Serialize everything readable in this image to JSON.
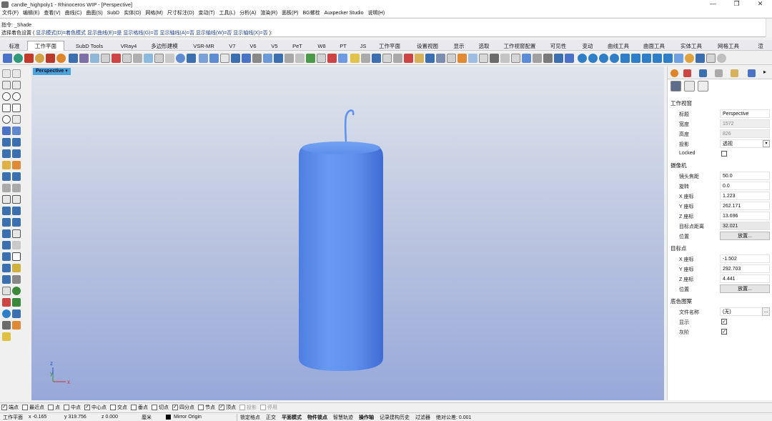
{
  "window": {
    "title": "candle_highpoly1 - Rhinoceros WIP - [Perspective]",
    "controls": [
      "—",
      "❐",
      "✕"
    ]
  },
  "menubar": [
    "文件(F)",
    "编辑(E)",
    "查看(V)",
    "曲线(C)",
    "曲面(S)",
    "SubD",
    "实体(O)",
    "网格(M)",
    "尺寸标注(D)",
    "变动(T)",
    "工具(L)",
    "分析(A)",
    "渲染(R)",
    "面板(P)",
    "BG螺栓",
    "Auxpecker Studio",
    "说明(H)"
  ],
  "command": {
    "history_line": "指令: _Shade",
    "prompt_line": {
      "prefix": "选择着色设置 (",
      "options": [
        "显示模式(D)=着色模式",
        "显示曲线(E)=是",
        "显示格线(G)=否",
        "显示轴线(A)=否",
        "显示轴线(W)=否",
        "显示轴线(X)=否"
      ],
      "suffix": "):"
    }
  },
  "tabs": [
    "标准",
    "工作平面",
    "SubD Tools",
    "VRay4",
    "多边形建模",
    "VSR-MR",
    "V7",
    "V6",
    "V5",
    "PeT",
    "W8",
    "PT",
    "JS",
    "工作平面",
    "设置视图",
    "显示",
    "选取",
    "工作视窗配置",
    "可见性",
    "变动",
    "曲线工具",
    "曲面工具",
    "实体工具",
    "网格工具",
    "渲"
  ],
  "active_tab_index": 1,
  "viewport": {
    "label": "Perspective",
    "axis_labels": {
      "z": "z",
      "y": "y",
      "x": "x"
    },
    "colors": {
      "bg_top": "#e0e4ec",
      "bg_bottom": "#97a8da",
      "object": "#5f90ee",
      "label_bg": "#4aa3d9"
    }
  },
  "properties": {
    "section_viewport": "工作视窗",
    "rows_viewport": [
      {
        "label": "标题",
        "value": "Perspective"
      },
      {
        "label": "宽度",
        "value": "1572",
        "disabled": true
      },
      {
        "label": "高度",
        "value": "826",
        "disabled": true
      },
      {
        "label": "投影",
        "value": "透视",
        "dropdown": true
      },
      {
        "label": "Locked",
        "checked": false
      }
    ],
    "section_camera": "摄像机",
    "rows_camera": [
      {
        "label": "镜头焦距",
        "value": "50.0"
      },
      {
        "label": "旋转",
        "value": "0.0"
      },
      {
        "label": "X 座标",
        "value": "1.223"
      },
      {
        "label": "Y 座标",
        "value": "262.171"
      },
      {
        "label": "Z 座标",
        "value": "13.696"
      },
      {
        "label": "目标点距离",
        "value": "32.021"
      },
      {
        "label": "位置",
        "button": "放置..."
      }
    ],
    "section_target": "目标点",
    "rows_target": [
      {
        "label": "X 座标",
        "value": "-1.502"
      },
      {
        "label": "Y 座标",
        "value": "292.703"
      },
      {
        "label": "Z 座标",
        "value": "4.441"
      },
      {
        "label": "位置",
        "button": "放置..."
      }
    ],
    "section_wallpaper": "底色图案",
    "rows_wallpaper": [
      {
        "label": "文件名称",
        "value": "(无)",
        "dots": "..."
      },
      {
        "label": "显示",
        "checked": true
      },
      {
        "label": "灰阶",
        "checked": true
      }
    ]
  },
  "osnaps": [
    {
      "label": "端点",
      "checked": true
    },
    {
      "label": "最近点",
      "checked": false
    },
    {
      "label": "点",
      "checked": false
    },
    {
      "label": "中点",
      "checked": false
    },
    {
      "label": "中心点",
      "checked": true
    },
    {
      "label": "交点",
      "checked": false
    },
    {
      "label": "垂点",
      "checked": false
    },
    {
      "label": "切点",
      "checked": false
    },
    {
      "label": "四分点",
      "checked": true
    },
    {
      "label": "节点",
      "checked": false
    },
    {
      "label": "顶点",
      "checked": true
    },
    {
      "label": "投影",
      "checked": false,
      "disabled": true
    },
    {
      "label": "停用",
      "checked": false,
      "disabled": true
    }
  ],
  "statusbar": {
    "cplane": "工作平面",
    "x": "x -0.165",
    "y": "y 319.756",
    "z": "z 0.000",
    "unit": "厘米",
    "layer": "Mirror Origin",
    "toggles": [
      {
        "label": "锁定格点",
        "bold": false
      },
      {
        "label": "正交",
        "bold": false
      },
      {
        "label": "平面模式",
        "bold": true
      },
      {
        "label": "物件锁点",
        "bold": true
      },
      {
        "label": "智慧轨迹",
        "bold": false
      },
      {
        "label": "操作轴",
        "bold": true
      },
      {
        "label": "记录建构历史",
        "bold": false
      },
      {
        "label": "过滤器",
        "bold": false
      }
    ],
    "tolerance": "绝对公差: 0.001"
  }
}
